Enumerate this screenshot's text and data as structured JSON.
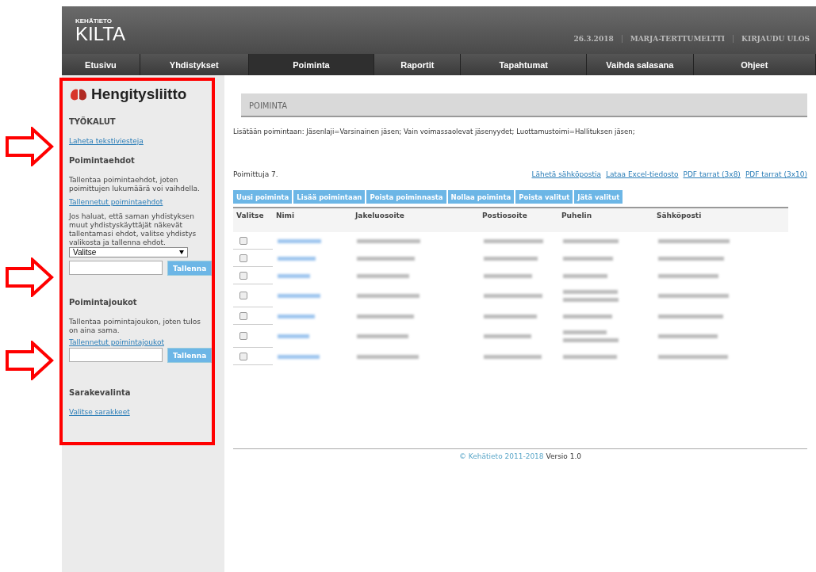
{
  "header": {
    "logo_small": "KEHÄTIETO",
    "logo_big": "KILTA",
    "date": "26.3.2018",
    "user": "MARJA-TERTTUMELTTI",
    "logout": "KIRJAUDU ULOS"
  },
  "nav": [
    {
      "label": "Etusivu",
      "selected": false
    },
    {
      "label": "Yhdistykset",
      "selected": false
    },
    {
      "label": "Poiminta",
      "selected": true
    },
    {
      "label": "Raportit",
      "selected": false
    },
    {
      "label": "Tapahtumat",
      "selected": false
    },
    {
      "label": "Vaihda salasana",
      "selected": false
    },
    {
      "label": "Ohjeet",
      "selected": false
    }
  ],
  "sidebar": {
    "brand": "Hengitysliitto",
    "tools_title": "TYÖKALUT",
    "sms_link": "Laheta tekstiviesteja",
    "criteria_title": "Poimintaehdot",
    "criteria_text": "Tallentaa poimintaehdot, joten poimittujen lukumäärä voi vaihdella.",
    "criteria_link": "Tallennetut poimintaehdot",
    "share_text": "Jos haluat, että saman yhdistyksen muut yhdistyskäyttäjät näkevät tallentamasi ehdot, valitse yhdistys valikosta ja tallenna ehdot.",
    "select_value": "Valitse",
    "save1": "Tallenna",
    "sets_title": "Poimintajoukot",
    "sets_text": "Tallentaa poimintajoukon, joten tulos on aina sama.",
    "sets_link": "Tallennetut poimintajoukot",
    "save2": "Tallenna",
    "columns_title": "Sarakevalinta",
    "columns_link": "Valitse sarakkeet"
  },
  "content": {
    "title": "POIMINTA",
    "info": "Lisätään poimintaan: Jäsenlaji=Varsinainen jäsen; Vain voimassaolevat jäsenyydet; Luottamustoimi=Hallituksen jäsen;",
    "count": "Poimittuja 7.",
    "links": [
      "Lähetä sähköpostia",
      "Lataa Excel-tiedosto",
      "PDF tarrat (3x8)",
      "PDF tarrat (3x10)"
    ],
    "buttons": [
      "Uusi poiminta",
      "Lisää poimintaan",
      "Poista poiminnasta",
      "Nollaa poiminta",
      "Poista valitut",
      "Jätä valitut"
    ],
    "table": {
      "columns": [
        "Valitse",
        "Nimi",
        "Jakeluosoite",
        "Postiosoite",
        "Puhelin",
        "Sähköposti"
      ],
      "rows": [
        {
          "checked": false,
          "kind": "single"
        },
        {
          "checked": false,
          "kind": "single"
        },
        {
          "checked": false,
          "kind": "single"
        },
        {
          "checked": false,
          "kind": "double"
        },
        {
          "checked": false,
          "kind": "single"
        },
        {
          "checked": false,
          "kind": "double"
        },
        {
          "checked": false,
          "kind": "single"
        }
      ]
    }
  },
  "footer": {
    "copyright": "© Kehätieto 2011-2018",
    "version": "Versio 1.0"
  },
  "annotations": [
    {
      "kind": "frame"
    },
    {
      "kind": "arrow"
    },
    {
      "kind": "arrow"
    },
    {
      "kind": "arrow"
    }
  ]
}
